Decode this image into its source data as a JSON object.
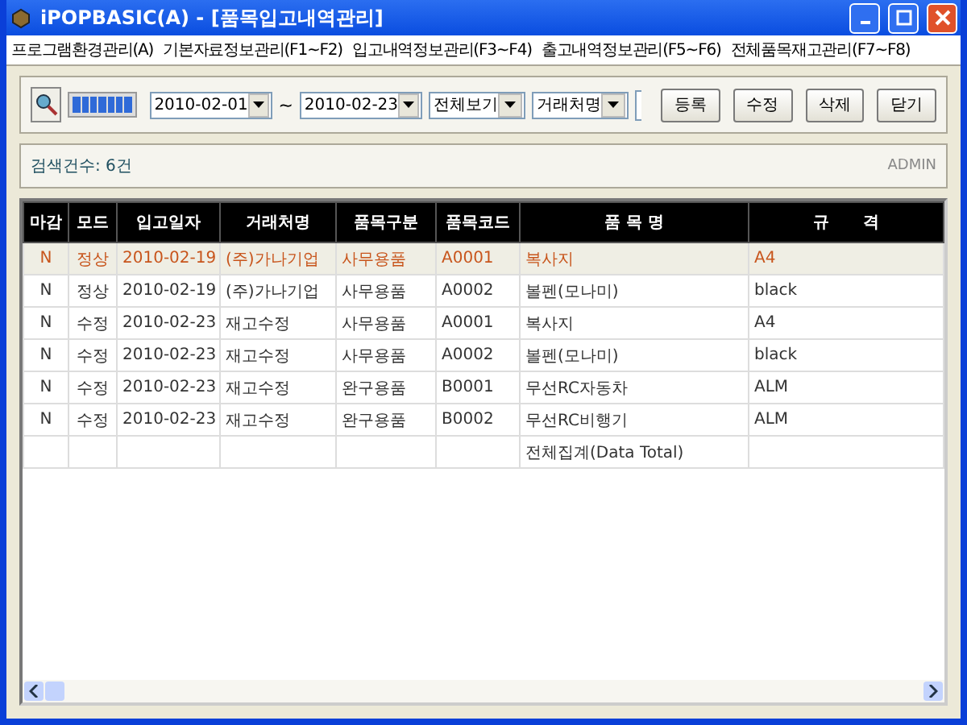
{
  "window": {
    "title": "iPOPBASIC(A) - [품목입고내역관리]"
  },
  "menu": [
    "프로그램환경관리(A)",
    "기본자료정보관리(F1~F2)",
    "입고내역정보관리(F3~F4)",
    "출고내역정보관리(F5~F6)",
    "전체품목재고관리(F7~F8)"
  ],
  "toolbar": {
    "date_from": "2010-02-01",
    "separator": "~",
    "date_to": "2010-02-23",
    "filters": [
      "전체보기",
      "거래처명"
    ],
    "buttons": [
      "등록",
      "수정",
      "삭제",
      "닫기"
    ]
  },
  "info": {
    "count": "검색건수: 6건",
    "user": "ADMIN"
  },
  "table": {
    "columns": [
      "마감",
      "모드",
      "입고일자",
      "거래처명",
      "품목구분",
      "품목코드",
      "품 목 명",
      "규      격"
    ],
    "rows": [
      {
        "selected": true,
        "cells": [
          "N",
          "정상",
          "2010-02-19",
          "(주)가나기업",
          "사무용품",
          "A0001",
          "복사지",
          "A4"
        ]
      },
      {
        "selected": false,
        "cells": [
          "N",
          "정상",
          "2010-02-19",
          "(주)가나기업",
          "사무용품",
          "A0002",
          "볼펜(모나미)",
          "black"
        ]
      },
      {
        "selected": false,
        "cells": [
          "N",
          "수정",
          "2010-02-23",
          "재고수정",
          "사무용품",
          "A0001",
          "복사지",
          "A4"
        ]
      },
      {
        "selected": false,
        "cells": [
          "N",
          "수정",
          "2010-02-23",
          "재고수정",
          "사무용품",
          "A0002",
          "볼펜(모나미)",
          "black"
        ]
      },
      {
        "selected": false,
        "cells": [
          "N",
          "수정",
          "2010-02-23",
          "재고수정",
          "완구용품",
          "B0001",
          "무선RC자동차",
          "ALM"
        ]
      },
      {
        "selected": false,
        "cells": [
          "N",
          "수정",
          "2010-02-23",
          "재고수정",
          "완구용품",
          "B0002",
          "무선RC비행기",
          "ALM"
        ]
      }
    ],
    "total_label": "전체집계(Data Total)"
  }
}
